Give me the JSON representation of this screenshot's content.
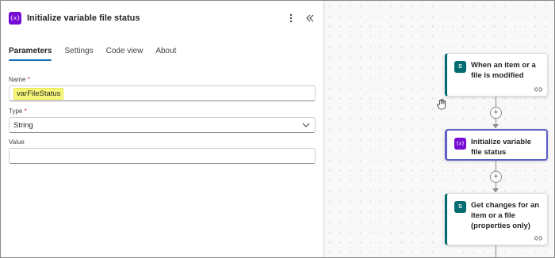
{
  "panel": {
    "icon": "variable-icon",
    "icon_glyph": "{x}",
    "title": "Initialize variable file status",
    "tabs": [
      {
        "label": "Parameters",
        "active": true
      },
      {
        "label": "Settings",
        "active": false
      },
      {
        "label": "Code view",
        "active": false
      },
      {
        "label": "About",
        "active": false
      }
    ],
    "fields": {
      "name": {
        "label": "Name",
        "required_mark": "*",
        "value": "varFileStatus"
      },
      "type": {
        "label": "Type",
        "required_mark": "*",
        "value": "String"
      },
      "value": {
        "label": "Value",
        "value": ""
      }
    }
  },
  "flow": {
    "nodes": [
      {
        "title": "When an item or a file is modified",
        "icon": "sharepoint-icon",
        "icon_glyph": "S",
        "selected": false
      },
      {
        "title": "Initialize variable file status",
        "icon": "variable-icon",
        "icon_glyph": "{x}",
        "selected": true
      },
      {
        "title": "Get changes for an item or a file (properties only)",
        "icon": "sharepoint-icon",
        "icon_glyph": "S",
        "selected": false
      }
    ],
    "add_glyph": "+"
  },
  "colors": {
    "variable": "#770bd6",
    "sharepoint": "#036c70",
    "accent": "#0f6cbd",
    "selected_border": "#5b5fc7",
    "highlight": "#f7f77a"
  }
}
